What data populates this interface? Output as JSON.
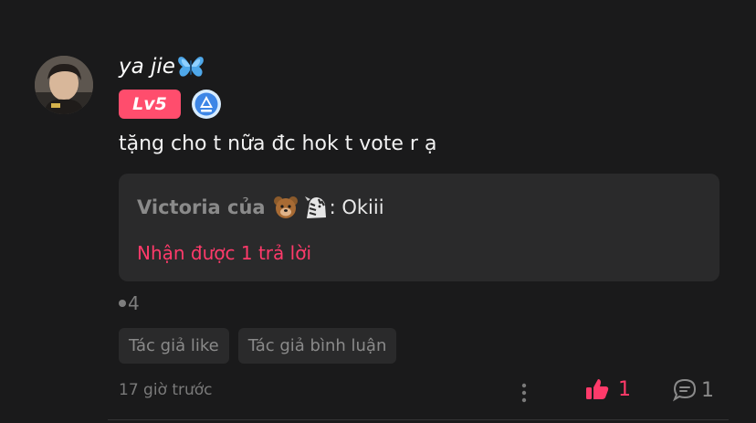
{
  "comment": {
    "username": "ya jie",
    "username_badge_icon": "butterfly-icon",
    "level": "Lv5",
    "medal_icon": "medal-icon",
    "text": "tặng cho t nữa đc hok t vote r ạ",
    "reply_preview": {
      "author": "Victoria của",
      "emojis": [
        "bear-face-icon",
        "zebra-face-icon"
      ],
      "text": ": Okiii",
      "reply_count_text": "Nhận được 1 trả lời"
    },
    "dot_count": "4",
    "tags": [
      "Tác giả like",
      "Tác giả bình luận"
    ],
    "time": "17 giờ trước",
    "likes": "1",
    "comments": "1"
  },
  "colors": {
    "background": "#1a1a1b",
    "accent": "#ff3a6a",
    "level_badge": "#ff4d6d",
    "card": "#2a2a2b"
  }
}
